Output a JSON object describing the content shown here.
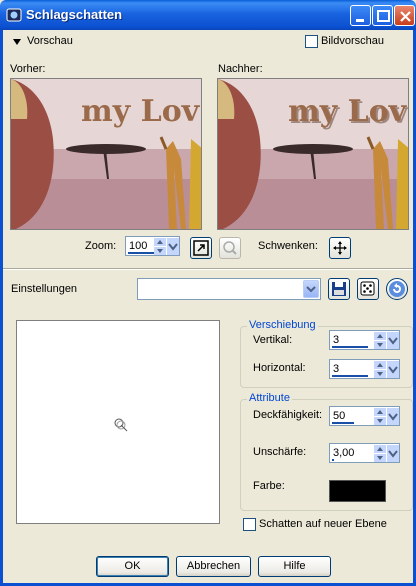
{
  "window": {
    "title": "Schlagschatten"
  },
  "preview": {
    "toggle_label": "Vorschau",
    "bild_checkbox_label": "Bildvorschau",
    "before_label": "Vorher:",
    "after_label": "Nachher:",
    "image_text": "my Lov"
  },
  "zoom": {
    "label": "Zoom:",
    "value": "100"
  },
  "pan": {
    "label": "Schwenken:"
  },
  "settings": {
    "label": "Einstellungen",
    "value": ""
  },
  "shift": {
    "title": "Verschiebung",
    "vertical_label": "Vertikal:",
    "vertical_value": "3",
    "horizontal_label": "Horizontal:",
    "horizontal_value": "3"
  },
  "attributes": {
    "title": "Attribute",
    "opacity_label": "Deckfähigkeit:",
    "opacity_value": "50",
    "blur_label": "Unschärfe:",
    "blur_value": "3,00",
    "color_label": "Farbe:",
    "color_value": "#000000"
  },
  "new_layer_checkbox_label": "Schatten auf neuer Ebene",
  "buttons": {
    "ok": "OK",
    "cancel": "Abbrechen",
    "help": "Hilfe"
  }
}
